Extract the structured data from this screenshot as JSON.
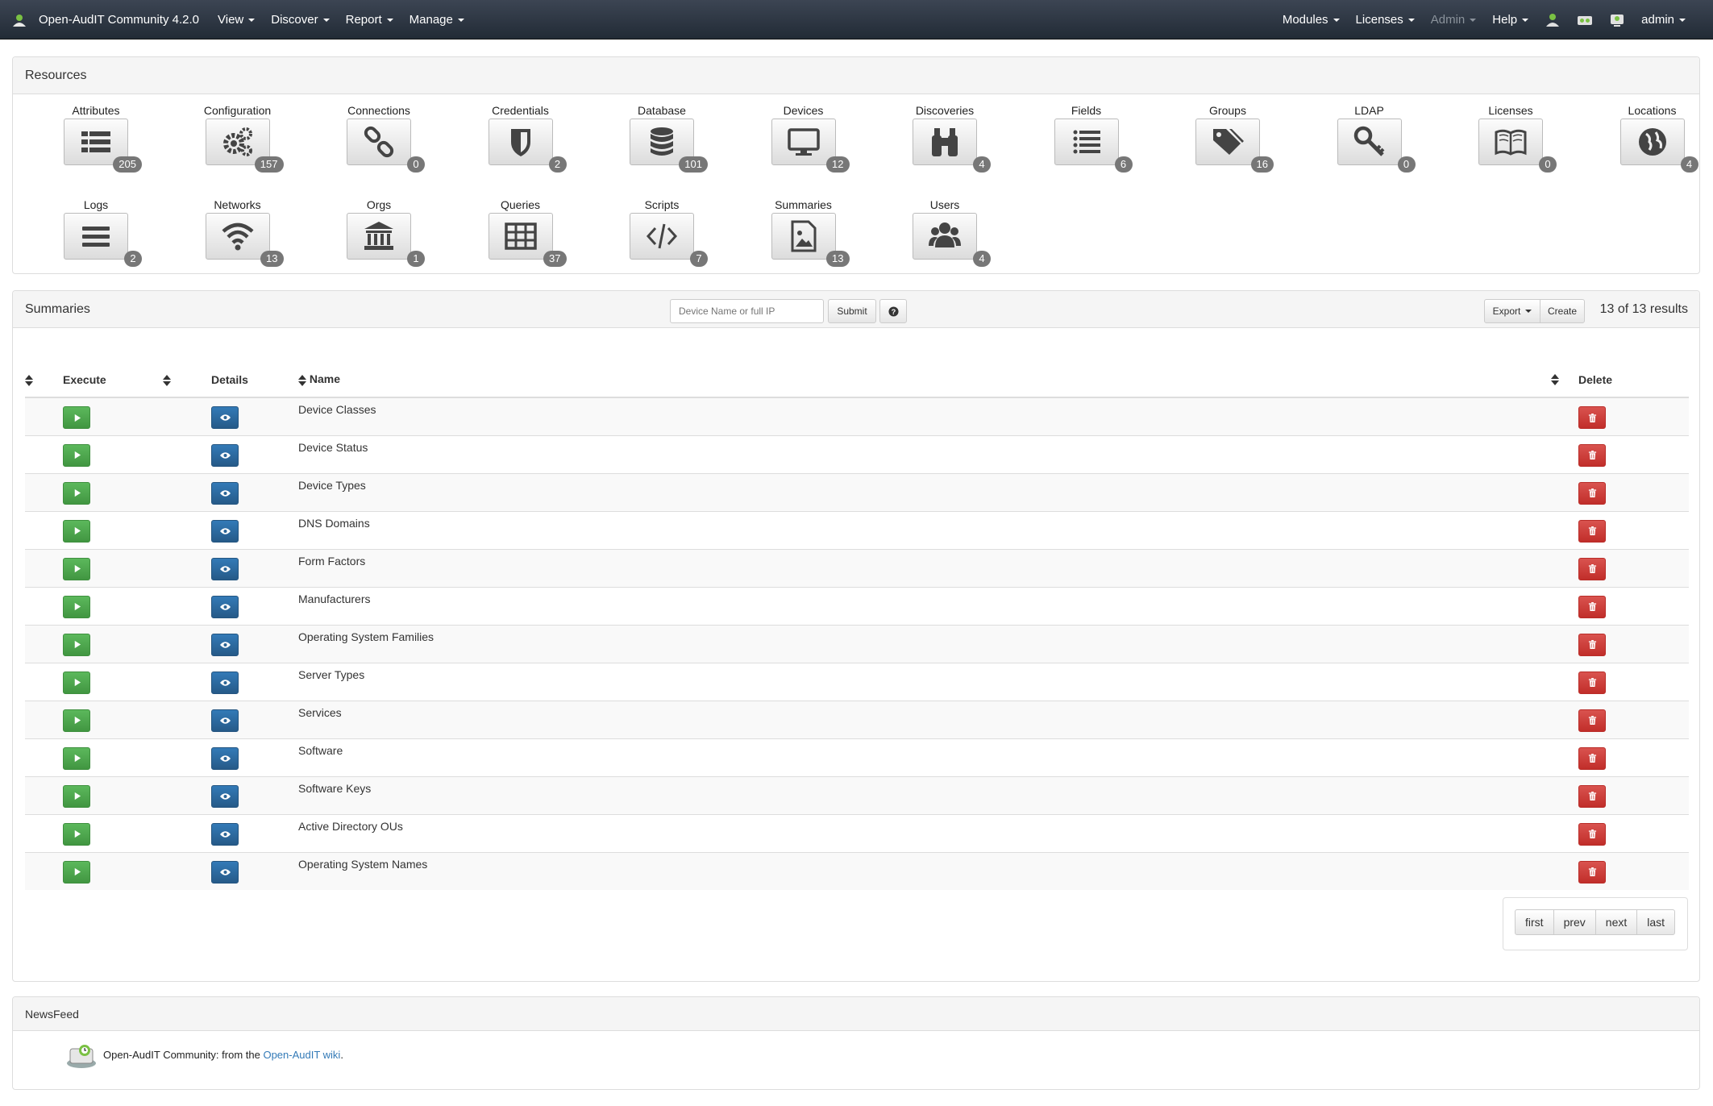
{
  "app": {
    "title": "Open-AudIT Community 4.2.0"
  },
  "nav": {
    "left": [
      {
        "label": "View"
      },
      {
        "label": "Discover"
      },
      {
        "label": "Report"
      },
      {
        "label": "Manage"
      }
    ],
    "right": [
      {
        "label": "Modules"
      },
      {
        "label": "Licenses"
      },
      {
        "label": "Admin"
      },
      {
        "label": "Help"
      }
    ],
    "user": "admin"
  },
  "resources": {
    "title": "Resources",
    "items": [
      {
        "label": "Attributes",
        "count": "205",
        "icon": "list-icon"
      },
      {
        "label": "Configuration",
        "count": "157",
        "icon": "gears-icon"
      },
      {
        "label": "Connections",
        "count": "0",
        "icon": "link-icon"
      },
      {
        "label": "Credentials",
        "count": "2",
        "icon": "shield-icon"
      },
      {
        "label": "Database",
        "count": "101",
        "icon": "database-icon"
      },
      {
        "label": "Devices",
        "count": "12",
        "icon": "desktop-icon"
      },
      {
        "label": "Discoveries",
        "count": "4",
        "icon": "binoculars-icon"
      },
      {
        "label": "Fields",
        "count": "6",
        "icon": "list-ul-icon"
      },
      {
        "label": "Groups",
        "count": "16",
        "icon": "tags-icon"
      },
      {
        "label": "LDAP",
        "count": "0",
        "icon": "key-icon"
      },
      {
        "label": "Licenses",
        "count": "0",
        "icon": "book-icon"
      },
      {
        "label": "Locations",
        "count": "4",
        "icon": "globe-icon"
      },
      {
        "label": "Logs",
        "count": "2",
        "icon": "bars-icon"
      },
      {
        "label": "Networks",
        "count": "13",
        "icon": "wifi-icon"
      },
      {
        "label": "Orgs",
        "count": "1",
        "icon": "bank-icon"
      },
      {
        "label": "Queries",
        "count": "37",
        "icon": "table-icon"
      },
      {
        "label": "Scripts",
        "count": "7",
        "icon": "code-icon"
      },
      {
        "label": "Summaries",
        "count": "13",
        "icon": "file-image-icon"
      },
      {
        "label": "Users",
        "count": "4",
        "icon": "users-icon"
      }
    ]
  },
  "summaries": {
    "title": "Summaries",
    "search_placeholder": "Device Name or full IP",
    "submit_label": "Submit",
    "export_label": "Export",
    "create_label": "Create",
    "results": "13 of 13 results",
    "columns": {
      "execute": "Execute",
      "details": "Details",
      "name": "Name",
      "delete": "Delete"
    },
    "rows": [
      "Device Classes",
      "Device Status",
      "Device Types",
      "DNS Domains",
      "Form Factors",
      "Manufacturers",
      "Operating System Families",
      "Server Types",
      "Services",
      "Software",
      "Software Keys",
      "Active Directory OUs",
      "Operating System Names"
    ],
    "pagination": {
      "first": "first",
      "prev": "prev",
      "next": "next",
      "last": "last"
    }
  },
  "newsfeed": {
    "title": "NewsFeed",
    "text": "Open-AudIT Community: from the ",
    "link": "Open-AudIT wiki",
    "suffix": "."
  },
  "colors": {
    "navbar": "#2b3440",
    "green": "#5cb85c",
    "blue": "#337ab7",
    "red": "#d9534f",
    "badge": "#777777"
  }
}
